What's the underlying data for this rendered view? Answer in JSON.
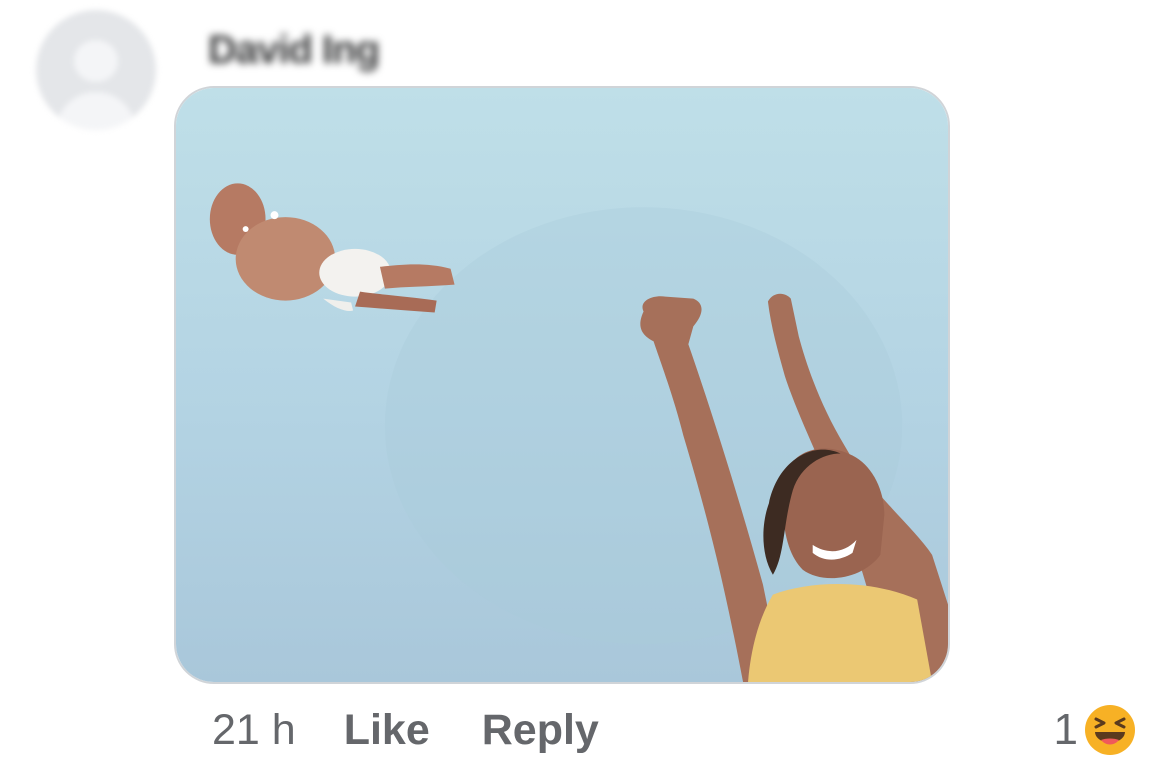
{
  "comment": {
    "author_name": "David Ing",
    "timestamp": "21 h",
    "like_label": "Like",
    "reply_label": "Reply",
    "reaction_count": "1",
    "reaction_type": "haha-emoji-icon"
  },
  "colors": {
    "secondary_text": "#65676b",
    "reaction_yellow": "#f7b125",
    "image_background": "#b9dbe5"
  }
}
